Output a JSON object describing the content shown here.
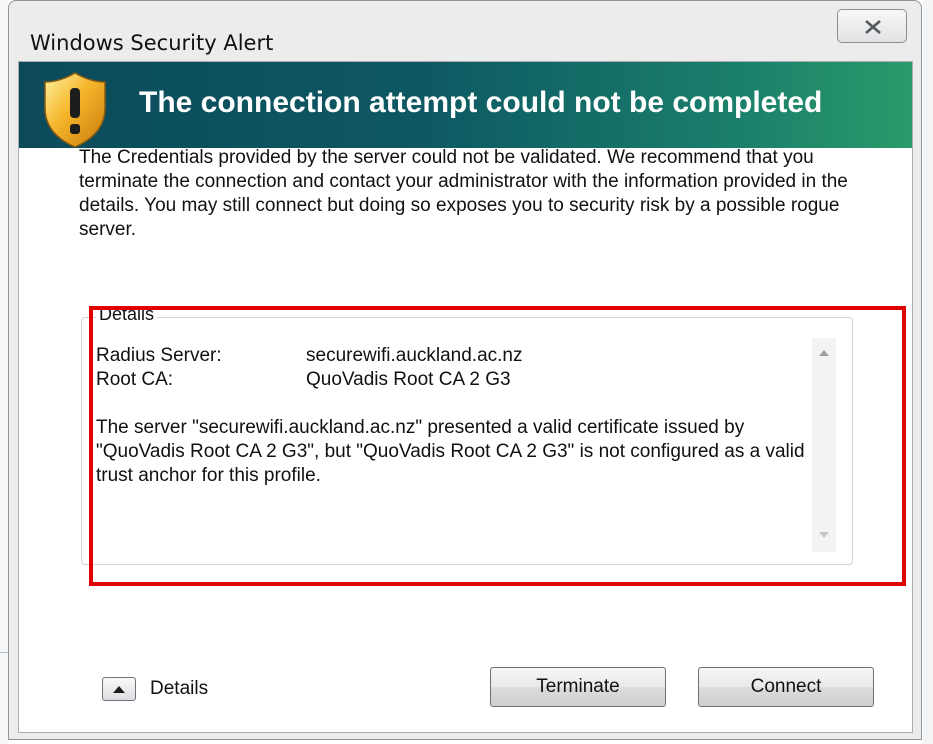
{
  "window": {
    "title": "Windows Security Alert",
    "close_icon": "close-icon"
  },
  "banner": {
    "icon": "shield-warning-icon",
    "title": "The connection attempt could not be completed"
  },
  "message": "The Credentials provided by the server could not be validated. We recommend that you terminate the connection and contact your administrator with the information provided in the details. You may still connect but doing so exposes you to security risk by a possible rogue server.",
  "details": {
    "legend": "Details",
    "radius_server_label": "Radius Server:",
    "radius_server_value": "securewifi.auckland.ac.nz",
    "root_ca_label": "Root CA:",
    "root_ca_value": "QuoVadis Root CA 2 G3",
    "text": "The server \"securewifi.auckland.ac.nz\" presented a valid certificate issued by \"QuoVadis Root CA 2 G3\", but \"QuoVadis Root CA 2 G3\" is not configured as a valid trust anchor for this profile."
  },
  "footer": {
    "details_toggle_label": "Details",
    "terminate_label": "Terminate",
    "connect_label": "Connect"
  },
  "colors": {
    "banner_start": "#0c4a5a",
    "banner_end": "#2a9a6a",
    "highlight": "#e00000"
  }
}
